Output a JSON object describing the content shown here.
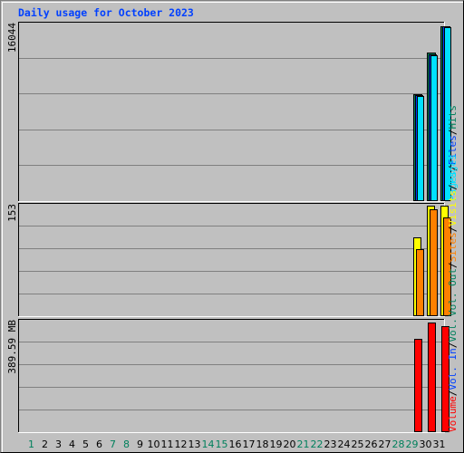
{
  "title": "Daily usage for October 2023",
  "chart_data": {
    "type": "bar",
    "title": "Daily usage for October 2023",
    "categories": [
      "1",
      "2",
      "3",
      "4",
      "5",
      "6",
      "7",
      "8",
      "9",
      "10",
      "11",
      "12",
      "13",
      "14",
      "15",
      "16",
      "17",
      "18",
      "19",
      "20",
      "21",
      "22",
      "23",
      "24",
      "25",
      "26",
      "27",
      "28",
      "29",
      "30",
      "31"
    ],
    "weekend_days": [
      "1",
      "7",
      "8",
      "14",
      "15",
      "21",
      "22",
      "28",
      "29"
    ],
    "day_label_colors": {
      "weekday": "#000000",
      "weekend": "#00805C"
    },
    "panels": [
      {
        "name": "hits-files-pages",
        "ymax_label": "16044",
        "ylim": [
          0,
          16044
        ],
        "grid": true,
        "legend": [
          {
            "label": "Pages",
            "color": "#00E0FF"
          },
          {
            "label": "Files",
            "color": "#0040FF"
          },
          {
            "label": "Hits",
            "color": "#00805C"
          }
        ],
        "series": [
          {
            "name": "Hits",
            "color": "#00805C",
            "values": [
              0,
              0,
              0,
              0,
              0,
              0,
              0,
              0,
              0,
              0,
              0,
              0,
              0,
              0,
              0,
              0,
              0,
              0,
              0,
              0,
              0,
              0,
              0,
              0,
              0,
              0,
              0,
              0,
              9560,
              13290,
              15640
            ]
          },
          {
            "name": "Files",
            "color": "#0040FF",
            "values": [
              0,
              0,
              0,
              0,
              0,
              0,
              0,
              0,
              0,
              0,
              0,
              0,
              0,
              0,
              0,
              0,
              0,
              0,
              0,
              0,
              0,
              0,
              0,
              0,
              0,
              0,
              0,
              0,
              9480,
              13130,
              15640
            ]
          },
          {
            "name": "Pages",
            "color": "#00E0FF",
            "values": [
              0,
              0,
              0,
              0,
              0,
              0,
              0,
              0,
              0,
              0,
              0,
              0,
              0,
              0,
              0,
              0,
              0,
              0,
              0,
              0,
              0,
              0,
              0,
              0,
              0,
              0,
              0,
              0,
              9400,
              13050,
              15560
            ]
          }
        ]
      },
      {
        "name": "visits-sites",
        "ymax_label": "153",
        "ylim": [
          0,
          153
        ],
        "grid": true,
        "legend": [
          {
            "label": "Vol. Out",
            "color": "#00805C"
          },
          {
            "label": "Sites",
            "color": "#FF8000"
          },
          {
            "label": "Visits",
            "color": "#FFFF00"
          },
          {
            "label": "Pages",
            "color": "#00E0FF"
          }
        ],
        "series": [
          {
            "name": "Visits",
            "color": "#FFFF00",
            "values": [
              0,
              0,
              0,
              0,
              0,
              0,
              0,
              0,
              0,
              0,
              0,
              0,
              0,
              0,
              0,
              0,
              0,
              0,
              0,
              0,
              0,
              0,
              0,
              0,
              0,
              0,
              0,
              0,
              106,
              149,
              149
            ]
          },
          {
            "name": "Sites",
            "color": "#FF8000",
            "values": [
              0,
              0,
              0,
              0,
              0,
              0,
              0,
              0,
              0,
              0,
              0,
              0,
              0,
              0,
              0,
              0,
              0,
              0,
              0,
              0,
              0,
              0,
              0,
              0,
              0,
              0,
              0,
              0,
              90,
              145,
              133
            ]
          }
        ]
      },
      {
        "name": "volume",
        "ymax_label": "389.59 MB",
        "ylim": [
          0,
          389.59
        ],
        "unit": "MB",
        "grid": true,
        "legend": [
          {
            "label": "Volume",
            "color": "#FF0000"
          },
          {
            "label": "Vol. In",
            "color": "#0040FF"
          },
          {
            "label": "Vol.",
            "color": "#00805C"
          }
        ],
        "series": [
          {
            "name": "Volume",
            "color": "#FF0000",
            "values": [
              0,
              0,
              0,
              0,
              0,
              0,
              0,
              0,
              0,
              0,
              0,
              0,
              0,
              0,
              0,
              0,
              0,
              0,
              0,
              0,
              0,
              0,
              0,
              0,
              0,
              0,
              0,
              0,
              321,
              377,
              364
            ]
          }
        ]
      }
    ],
    "legend_placement": "right (vertical)"
  }
}
